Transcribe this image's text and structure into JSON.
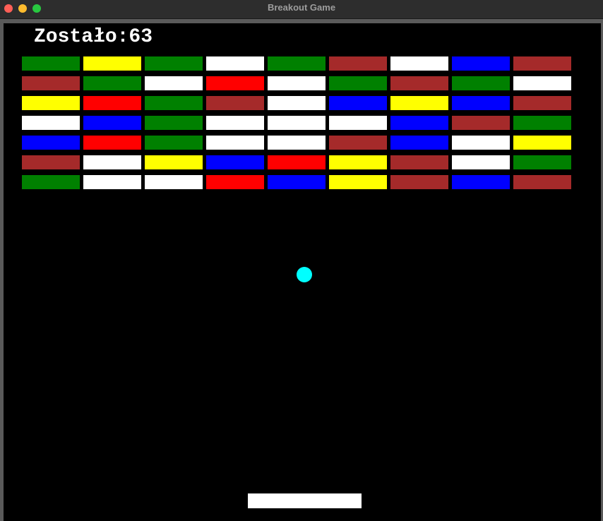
{
  "window": {
    "title": "Breakout Game",
    "controls": {
      "close_color": "#ff5f57",
      "minimize_color": "#febc2e",
      "zoom_color": "#28c840"
    }
  },
  "game": {
    "score_text": "Zostało:63",
    "bricks_remaining": 63,
    "background_color": "#000000",
    "ball_color": "#00ffff",
    "paddle_color": "#ffffff",
    "palette": {
      "green": "#008000",
      "yellow": "#ffff00",
      "white": "#ffffff",
      "brown": "#a52a2a",
      "red": "#ff0000",
      "blue": "#0000ff"
    },
    "brick_rows": [
      [
        "green",
        "yellow",
        "green",
        "white",
        "green",
        "brown",
        "white",
        "blue",
        "brown"
      ],
      [
        "brown",
        "green",
        "white",
        "red",
        "white",
        "green",
        "brown",
        "green",
        "white"
      ],
      [
        "yellow",
        "red",
        "green",
        "brown",
        "white",
        "blue",
        "yellow",
        "blue",
        "brown"
      ],
      [
        "white",
        "blue",
        "green",
        "white",
        "white",
        "white",
        "blue",
        "brown",
        "green"
      ],
      [
        "blue",
        "red",
        "green",
        "white",
        "white",
        "brown",
        "blue",
        "white",
        "yellow"
      ],
      [
        "brown",
        "white",
        "yellow",
        "blue",
        "red",
        "yellow",
        "brown",
        "white",
        "green"
      ],
      [
        "green",
        "white",
        "white",
        "red",
        "blue",
        "yellow",
        "brown",
        "blue",
        "brown"
      ]
    ]
  }
}
